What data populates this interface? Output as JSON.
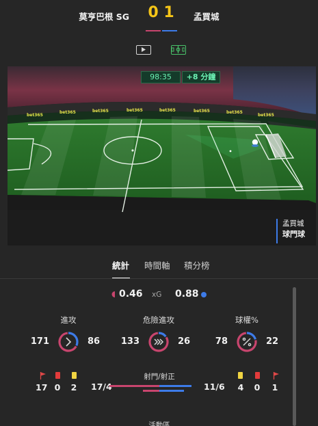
{
  "match": {
    "home_team": "莫亨巴根 SG",
    "away_team": "孟買城",
    "home_score": "0",
    "away_score": "1"
  },
  "view_toggles": [
    "video-icon",
    "pitch-icon"
  ],
  "pitch": {
    "clock": "98:35",
    "added_time": "+8 分鐘",
    "sponsor": "bet365",
    "event_team": "孟買城",
    "event_type": "球門球"
  },
  "tabs": {
    "stats": "統計",
    "timeline": "時間軸",
    "standings": "積分榜"
  },
  "xg": {
    "home": "0.46",
    "label": "xG",
    "away": "0.88"
  },
  "rings": [
    {
      "title": "進攻",
      "home": "171",
      "away": "86",
      "home_share": 0.665,
      "icon": "chevron-right-icon"
    },
    {
      "title": "危險進攻",
      "home": "133",
      "away": "26",
      "home_share": 0.836,
      "icon": "triple-chevron-icon"
    },
    {
      "title": "球權%",
      "home": "78",
      "away": "22",
      "home_share": 0.78,
      "icon": "percent-icon"
    }
  ],
  "cards": {
    "home": {
      "corners": "17",
      "red": "0",
      "yellow": "2"
    },
    "away": {
      "yellow": "4",
      "red": "0",
      "corners": "1"
    }
  },
  "shots": {
    "title": "射門/射正",
    "home": "17/4",
    "away": "11/6",
    "home_shots": 17,
    "away_shots": 11,
    "home_on_target": 4,
    "away_on_target": 6
  },
  "next_section_title": "活動區",
  "colors": {
    "home": "#c8456e",
    "away": "#3d7be8",
    "score": "#f5c518",
    "clock_text": "#6cf2b4"
  }
}
